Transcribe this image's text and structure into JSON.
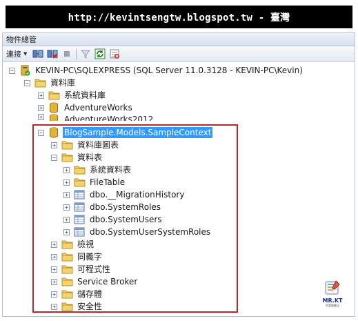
{
  "banner": {
    "text": "http://kevintsengtw.blogspot.tw - 臺灣"
  },
  "panel": {
    "title": "物件總管"
  },
  "toolbar": {
    "connect_label": "連接"
  },
  "tree": {
    "server": "KEVIN-PC\\SQLEXPRESS (SQL Server 11.0.3128 - KEVIN-PC\\Kevin)",
    "databases": "資料庫",
    "system_databases": "系統資料庫",
    "adventureworks": "AdventureWorks",
    "adventureworks2012": "AdventureWorks2012",
    "blogsample": "BlogSample.Models.SampleContext",
    "diagrams": "資料庫圖表",
    "tables": "資料表",
    "system_tables": "系統資料表",
    "filetable": "FileTable",
    "migration_history": "dbo.__MigrationHistory",
    "system_roles": "dbo.SystemRoles",
    "system_users": "dbo.SystemUsers",
    "system_user_system_roles": "dbo.SystemUserSystemRoles",
    "views": "檢視",
    "synonyms": "同義字",
    "programmability": "可程式性",
    "service_broker": "Service Broker",
    "storage": "儲存體",
    "security": "安全性"
  },
  "logo": {
    "name": "MR.KT",
    "tagline": "的電腦筆記"
  },
  "colors": {
    "selection": "#3399ff",
    "highlight_border": "#b5272d",
    "banner_bg": "#000000",
    "folder": "#e8c35a",
    "database": "#d9a62c"
  }
}
